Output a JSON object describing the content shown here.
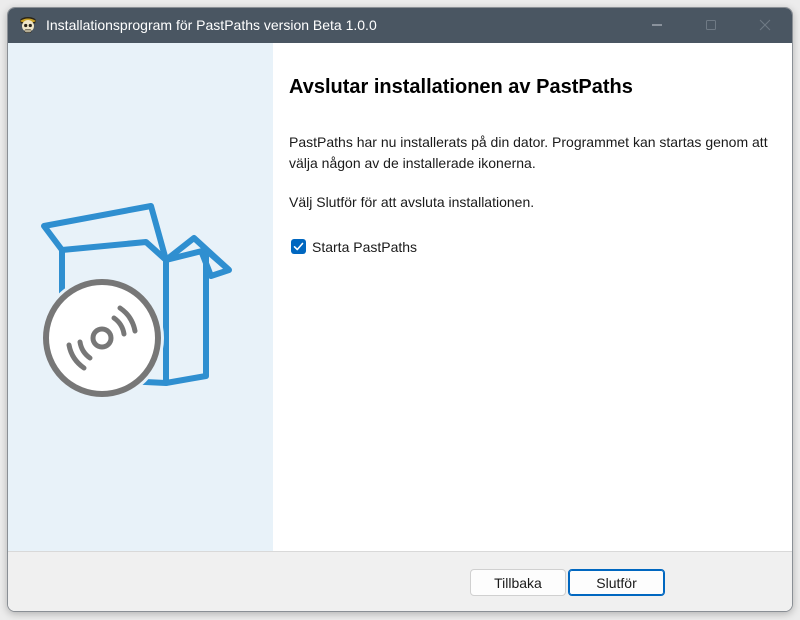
{
  "window": {
    "title": "Installationsprogram för PastPaths version Beta 1.0.0",
    "app_icon": "pirate-skull-icon",
    "controls": [
      "minimize-icon",
      "maximize-icon",
      "close-icon"
    ]
  },
  "left_panel": {
    "illustration": "box-with-disc-illustration",
    "colors": {
      "box": "#2f8fd0",
      "disc": "#777777",
      "background": "#e8f2f9"
    }
  },
  "main": {
    "heading": "Avslutar installationen av PastPaths",
    "paragraph1": "PastPaths har nu installerats på din dator. Programmet kan startas genom att välja någon av de installerade ikonerna.",
    "paragraph2": "Välj Slutför för att avsluta installationen.",
    "checkbox": {
      "label": "Starta PastPaths",
      "checked": true
    }
  },
  "footer": {
    "back_label": "Tillbaka",
    "finish_label": "Slutför"
  },
  "colors": {
    "titlebar": "#4a5662",
    "accent": "#0067c0"
  }
}
